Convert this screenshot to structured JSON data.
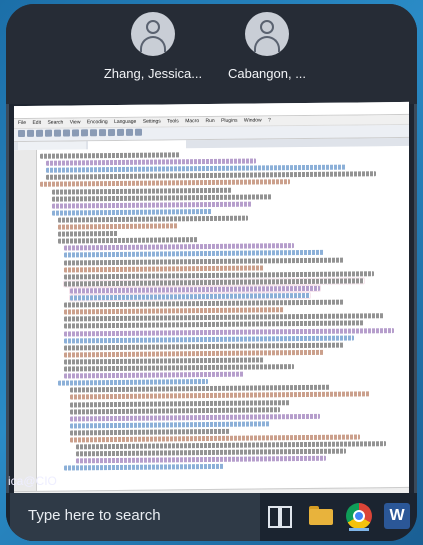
{
  "call": {
    "participants": [
      {
        "name": "Zhang, Jessica..."
      },
      {
        "name": "Cabangon, ..."
      }
    ]
  },
  "self_label": "ica@CIO",
  "taskbar": {
    "search_placeholder": "Type here to search",
    "icons": [
      "task-view-icon",
      "file-explorer-icon",
      "chrome-icon",
      "word-icon"
    ]
  },
  "shared_screen": {
    "editor": "Notepad++",
    "menus": [
      "File",
      "Edit",
      "Search",
      "View",
      "Encoding",
      "Language",
      "Settings",
      "Tools",
      "Macro",
      "Run",
      "Plugins",
      "Window",
      "?"
    ]
  },
  "colors": {
    "brand_word": "#2b5797",
    "folder": "#e8b33c",
    "taskbar": "#1b2430"
  }
}
